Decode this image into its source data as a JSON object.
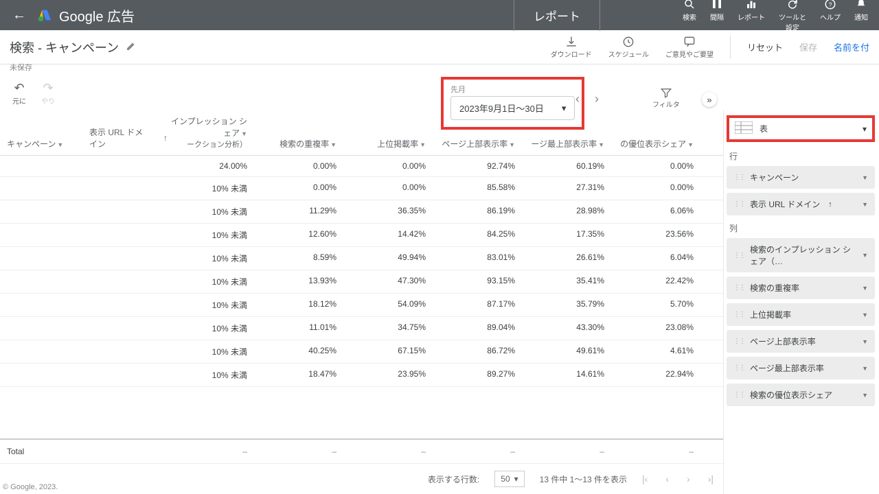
{
  "top": {
    "brand": "Google 広告",
    "report_tab": "レポート",
    "icons": {
      "search": "検索",
      "range": "間隔",
      "report": "レポート",
      "tools": "ツールと\n設定",
      "help": "ヘルプ",
      "notify": "通知"
    }
  },
  "sub": {
    "title": "検索 - キャンペーン",
    "unsaved": "未保存",
    "download": "ダウンロード",
    "schedule": "スケジュール",
    "feedback": "ご意見やご要望",
    "reset": "リセット",
    "save": "保存",
    "save_as": "名前を付"
  },
  "toolbar": {
    "date_caption": "先月",
    "date_range": "2023年9月1日～30日",
    "filter": "フィルタ",
    "undo": "元に",
    "redo": "やり"
  },
  "columns": {
    "campaign": "キャンペーン",
    "domain": "表示 URL ドメイン",
    "imp_share": "インプレッション シェア",
    "imp_sub": "ークション分析）",
    "overlap": "検索の重複率",
    "top_pos": "上位掲載率",
    "page_top": "ページ上部表示率",
    "abs_top": "ージ最上部表示率",
    "outrank": "の優位表示シェア"
  },
  "rows": [
    {
      "imp": "24.00%",
      "overlap": "0.00%",
      "top": "0.00%",
      "pt": "92.74%",
      "at": "60.19%",
      "or": "0.00%"
    },
    {
      "imp": "10% 未満",
      "overlap": "0.00%",
      "top": "0.00%",
      "pt": "85.58%",
      "at": "27.31%",
      "or": "0.00%"
    },
    {
      "imp": "10% 未満",
      "overlap": "11.29%",
      "top": "36.35%",
      "pt": "86.19%",
      "at": "28.98%",
      "or": "6.06%"
    },
    {
      "imp": "10% 未満",
      "overlap": "12.60%",
      "top": "14.42%",
      "pt": "84.25%",
      "at": "17.35%",
      "or": "23.56%"
    },
    {
      "imp": "10% 未満",
      "overlap": "8.59%",
      "top": "49.94%",
      "pt": "83.01%",
      "at": "26.61%",
      "or": "6.04%"
    },
    {
      "imp": "10% 未満",
      "overlap": "13.93%",
      "top": "47.30%",
      "pt": "93.15%",
      "at": "35.41%",
      "or": "22.42%"
    },
    {
      "imp": "10% 未満",
      "overlap": "18.12%",
      "top": "54.09%",
      "pt": "87.17%",
      "at": "35.79%",
      "or": "5.70%"
    },
    {
      "imp": "10% 未満",
      "overlap": "11.01%",
      "top": "34.75%",
      "pt": "89.04%",
      "at": "43.30%",
      "or": "23.08%"
    },
    {
      "imp": "10% 未満",
      "overlap": "40.25%",
      "top": "67.15%",
      "pt": "86.72%",
      "at": "49.61%",
      "or": "4.61%"
    },
    {
      "imp": "10% 未満",
      "overlap": "18.47%",
      "top": "23.95%",
      "pt": "89.27%",
      "at": "14.61%",
      "or": "22.94%"
    }
  ],
  "total_label": "Total",
  "dash": "–",
  "pager": {
    "rows_label": "表示する行数:",
    "rows_value": "50",
    "summary": "13 件中 1～13 件を表示"
  },
  "panel": {
    "viz": "表",
    "rows_label": "行",
    "cols_label": "列",
    "row_chips": [
      "キャンペーン",
      "表示 URL ドメイン"
    ],
    "col_chips": [
      "検索のインプレッション シェア（…",
      "検索の重複率",
      "上位掲載率",
      "ページ上部表示率",
      "ページ最上部表示率",
      "検索の優位表示シェア"
    ]
  },
  "footer": "© Google, 2023."
}
